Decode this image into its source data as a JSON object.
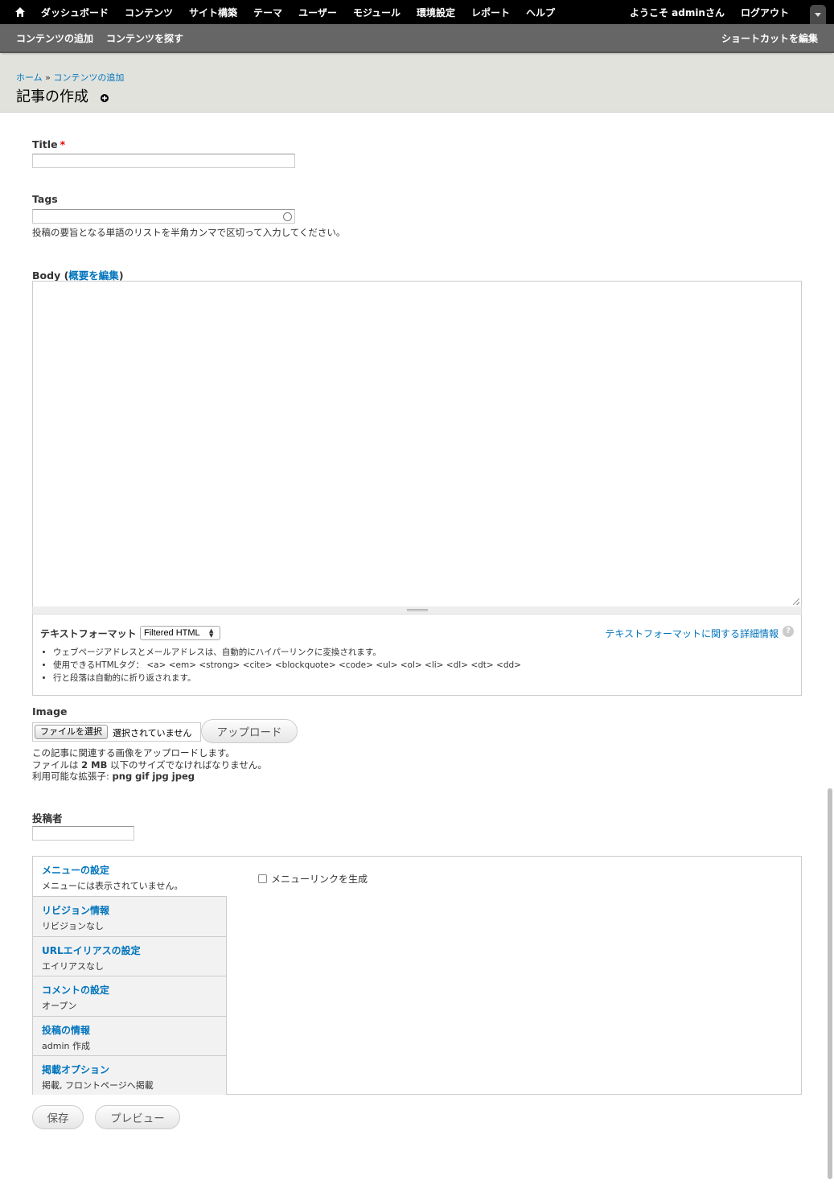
{
  "toolbar": {
    "menu": [
      "ダッシュボード",
      "コンテンツ",
      "サイト構築",
      "テーマ",
      "ユーザー",
      "モジュール",
      "環境設定",
      "レポート",
      "ヘルプ"
    ],
    "welcome": "ようこそ adminさん",
    "logout": "ログアウト"
  },
  "shortcuts": {
    "items": [
      "コンテンツの追加",
      "コンテンツを探す"
    ],
    "edit": "ショートカットを編集"
  },
  "breadcrumb": {
    "home": "ホーム",
    "sep": "»",
    "current": "コンテンツの追加"
  },
  "page_title": "記事の作成",
  "form": {
    "title_label": "Title",
    "required_mark": "*",
    "tags_label": "Tags",
    "tags_desc": "投稿の要旨となる単語のリストを半角カンマで区切って入力してください。",
    "body_label": "Body",
    "body_open": " (",
    "body_summary_link": "概要を編集",
    "body_close": ")",
    "format_label": "テキストフォーマット",
    "format_value": "Filtered HTML",
    "format_help": "テキストフォーマットに関する詳細情報",
    "format_tips": [
      "ウェブページアドレスとメールアドレスは、自動的にハイパーリンクに変換されます。",
      "使用できるHTMLタグ： <a> <em> <strong> <cite> <blockquote> <code> <ul> <ol> <li> <dl> <dt> <dd>",
      "行と段落は自動的に折り返されます。"
    ],
    "image_label": "Image",
    "file_choose": "ファイルを選択",
    "file_none": "選択されていません",
    "upload_button": "アップロード",
    "image_desc_1": "この記事に関連する画像をアップロードします。",
    "image_desc_2_pre": "ファイルは ",
    "image_desc_2_size": "2 MB",
    "image_desc_2_post": " 以下のサイズでなければなりません。",
    "image_desc_3_pre": "利用可能な拡張子: ",
    "image_desc_3_ext": "png gif jpg jpeg",
    "author_label": "投稿者"
  },
  "vertical_tabs": [
    {
      "title": "メニューの設定",
      "summary": "メニューには表示されていません。"
    },
    {
      "title": "リビジョン情報",
      "summary": "リビジョンなし"
    },
    {
      "title": "URLエイリアスの設定",
      "summary": "エイリアスなし"
    },
    {
      "title": "コメントの設定",
      "summary": "オープン"
    },
    {
      "title": "投稿の情報",
      "summary": "admin 作成"
    },
    {
      "title": "掲載オプション",
      "summary": "掲載, フロントページへ掲載"
    }
  ],
  "menu_pane": {
    "checkbox_label": "メニューリンクを生成"
  },
  "actions": {
    "save": "保存",
    "preview": "プレビュー"
  }
}
